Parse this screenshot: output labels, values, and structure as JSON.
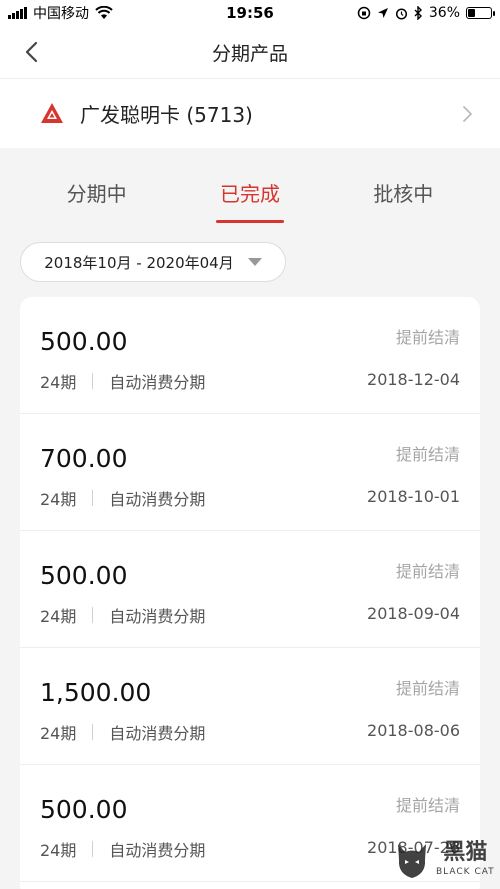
{
  "status_bar": {
    "carrier": "中国移动",
    "time": "19:56",
    "battery": "36%",
    "battery_level": 0.36
  },
  "nav": {
    "title": "分期产品"
  },
  "card": {
    "name": "广发聪明卡 (5713)"
  },
  "tabs": [
    {
      "label": "分期中",
      "active": false
    },
    {
      "label": "已完成",
      "active": true
    },
    {
      "label": "批核中",
      "active": false
    }
  ],
  "filter": {
    "date_range": "2018年10月 - 2020年04月"
  },
  "items": [
    {
      "amount": "500.00",
      "periods": "24期",
      "type": "自动消费分期",
      "date": "2018-12-04",
      "action": "提前结清"
    },
    {
      "amount": "700.00",
      "periods": "24期",
      "type": "自动消费分期",
      "date": "2018-10-01",
      "action": "提前结清"
    },
    {
      "amount": "500.00",
      "periods": "24期",
      "type": "自动消费分期",
      "date": "2018-09-04",
      "action": "提前结清"
    },
    {
      "amount": "1,500.00",
      "periods": "24期",
      "type": "自动消费分期",
      "date": "2018-08-06",
      "action": "提前结清"
    },
    {
      "amount": "500.00",
      "periods": "24期",
      "type": "自动消费分期",
      "date": "2018-07-26",
      "action": "提前结清"
    }
  ],
  "watermark": {
    "cn": "黑猫",
    "en": "BLACK CAT"
  },
  "colors": {
    "accent": "#d7352f",
    "background": "#f4f4f4",
    "muted": "#a5a5a5"
  }
}
